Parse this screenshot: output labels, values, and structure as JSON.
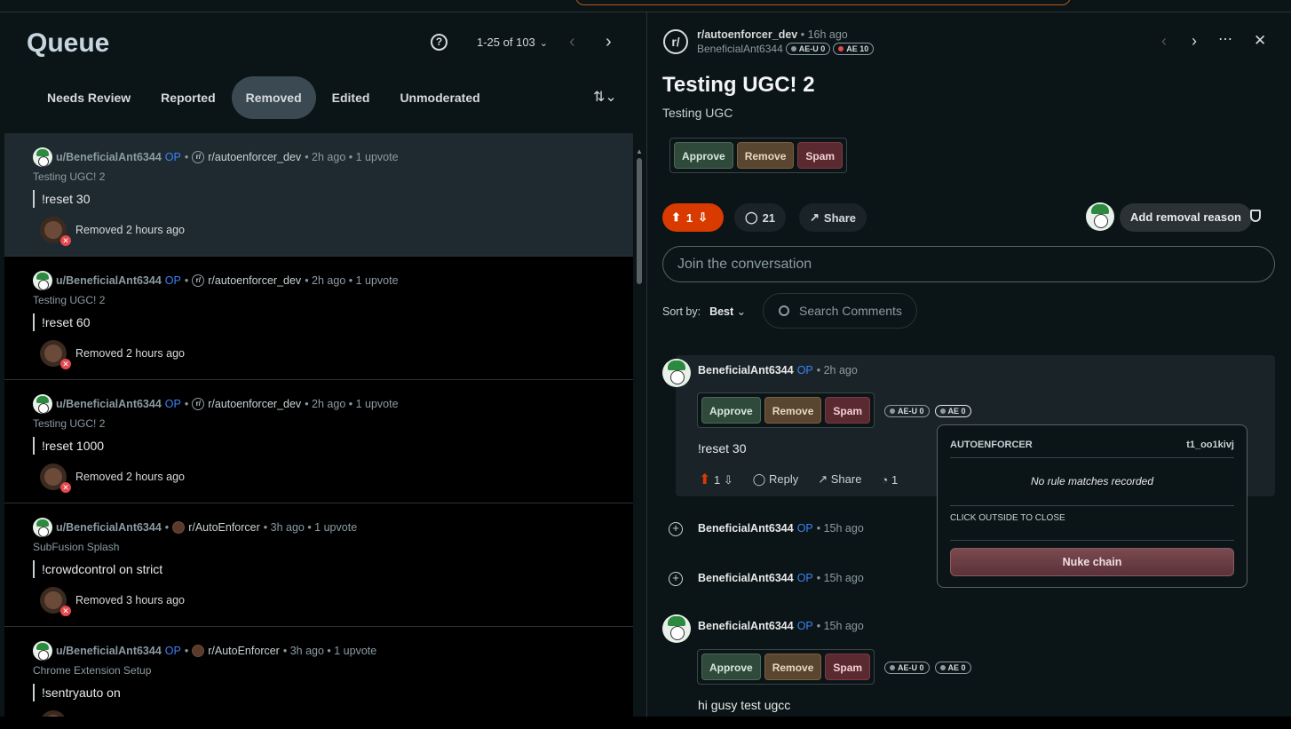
{
  "queue": {
    "title": "Queue",
    "pager": "1-25 of 103",
    "tabs": [
      "Needs Review",
      "Reported",
      "Removed",
      "Edited",
      "Unmoderated"
    ],
    "active_tab": "Removed",
    "items": [
      {
        "user": "u/BeneficialAnt6344",
        "op": "OP",
        "sub": "r/autoenforcer_dev",
        "meta": "• 2h ago • 1 upvote",
        "title": "Testing UGC! 2",
        "body": "!reset 30",
        "status": "Removed 2 hours ago",
        "selected": true
      },
      {
        "user": "u/BeneficialAnt6344",
        "op": "OP",
        "sub": "r/autoenforcer_dev",
        "meta": "• 2h ago • 1 upvote",
        "title": "Testing UGC! 2",
        "body": "!reset 60",
        "status": "Removed 2 hours ago"
      },
      {
        "user": "u/BeneficialAnt6344",
        "op": "OP",
        "sub": "r/autoenforcer_dev",
        "meta": "• 2h ago • 1 upvote",
        "title": "Testing UGC! 2",
        "body": "!reset 1000",
        "status": "Removed 2 hours ago"
      },
      {
        "user": "u/BeneficialAnt6344",
        "op": "",
        "sub": "r/AutoEnforcer",
        "meta": "• 3h ago • 1 upvote",
        "title": "SubFusion Splash",
        "body": "!crowdcontrol on strict",
        "status": "Removed 3 hours ago"
      },
      {
        "user": "u/BeneficialAnt6344",
        "op": "OP",
        "sub": "r/AutoEnforcer",
        "meta": "• 3h ago • 1 upvote",
        "title": "Chrome Extension Setup",
        "body": "!sentryauto on",
        "status": ""
      }
    ]
  },
  "post": {
    "subreddit": "r/autoenforcer_dev",
    "time": "• 16h ago",
    "author": "BeneficialAnt6344",
    "badges": [
      "AE-U 0",
      "AE 10"
    ],
    "title": "Testing UGC! 2",
    "body": "Testing UGC",
    "mod_buttons": {
      "approve": "Approve",
      "remove": "Remove",
      "spam": "Spam"
    },
    "votes": "1",
    "comments": "21",
    "share": "Share",
    "add_removal_reason": "Add removal reason",
    "join_placeholder": "Join the conversation",
    "sort_label": "Sort by:",
    "sort_value": "Best",
    "search_placeholder": "Search Comments"
  },
  "comments": [
    {
      "user": "BeneficialAnt6344",
      "op": "OP",
      "time": "• 2h ago",
      "badges": [
        "AE-U 0",
        "AE 0"
      ],
      "body": "!reset 30",
      "votes": "1",
      "reply": "Reply",
      "share": "Share",
      "history": "1"
    },
    {
      "user": "BeneficialAnt6344",
      "op": "OP",
      "time": "• 15h ago"
    },
    {
      "user": "BeneficialAnt6344",
      "op": "OP",
      "time": "• 15h ago"
    },
    {
      "user": "BeneficialAnt6344",
      "op": "OP",
      "time": "• 15h ago",
      "badges": [
        "AE-U 0",
        "AE 0"
      ],
      "body": "hi gusy test ugcc"
    }
  ],
  "popup": {
    "title": "AUTOENFORCER",
    "id": "t1_oo1kivj",
    "message": "No rule matches recorded",
    "hint": "CLICK OUTSIDE TO CLOSE",
    "button": "Nuke chain"
  },
  "colors": {
    "accent": "#d93a00",
    "op": "#3b82f6",
    "panel": "#0b1416"
  }
}
